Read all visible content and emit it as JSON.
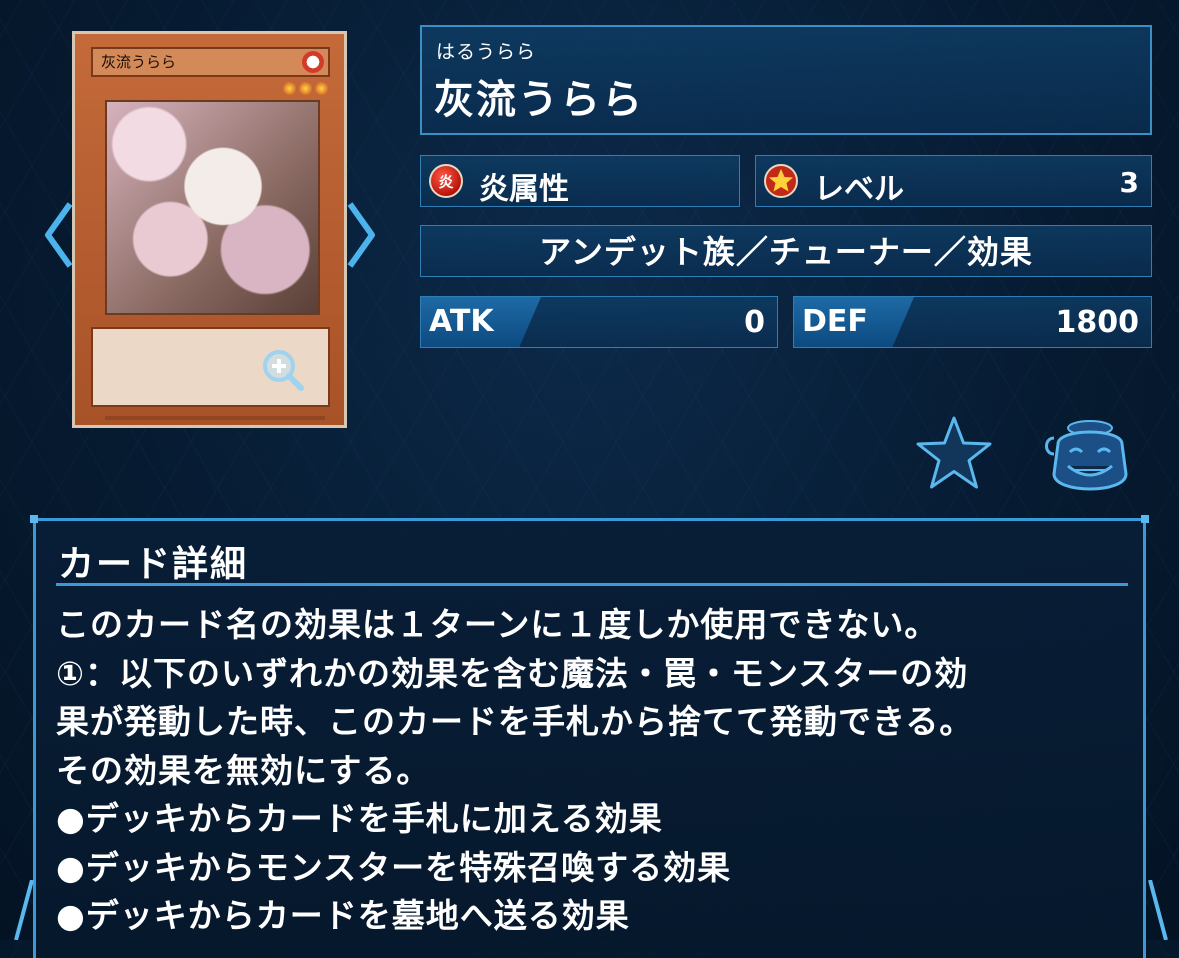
{
  "card_image": {
    "name_text": "灰流うらら"
  },
  "card": {
    "reading": "はるうらら",
    "name": "灰流うらら",
    "attribute_badge": "炎",
    "attribute_label": "炎属性",
    "level_label": "レベル",
    "level_value": "3",
    "type_line": "アンデット族／チューナー／効果",
    "atk_label": "ATK",
    "atk_value": "0",
    "def_label": "DEF",
    "def_value": "1800"
  },
  "details": {
    "title": "カード詳細",
    "lines": [
      "このカード名の効果は１ターンに１度しか使用できない。",
      "①：以下のいずれかの効果を含む魔法・罠・モンスターの効",
      "果が発動した時、このカードを手札から捨てて発動できる。",
      "その効果を無効にする。",
      "●デッキからカードを手札に加える効果",
      "●デッキからモンスターを特殊召喚する効果",
      "●デッキからカードを墓地へ送る効果"
    ]
  },
  "icons": {
    "prev": "chevron-left-icon",
    "next": "chevron-right-icon",
    "zoom": "zoom-in-icon",
    "favorite": "star-icon",
    "pot": "pot-of-greed-icon"
  },
  "colors": {
    "accent": "#3a9ad8",
    "attribute_fire": "#d23a2a",
    "panel": "#0e3c64"
  }
}
